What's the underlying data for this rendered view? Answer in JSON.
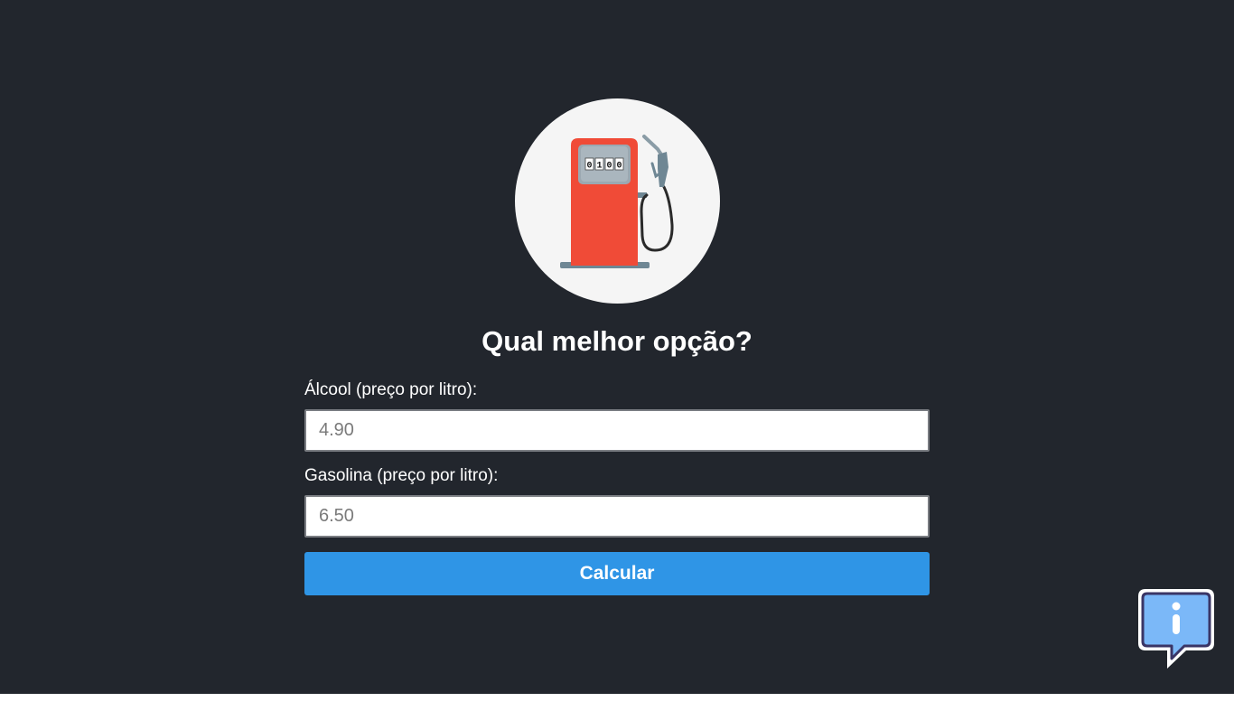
{
  "logo": {
    "icon": "fuel-pump-icon",
    "counter_digits": [
      "0",
      "1",
      "0",
      "0"
    ]
  },
  "title": "Qual melhor opção?",
  "form": {
    "alcool": {
      "label": "Álcool (preço por litro):",
      "placeholder": "4.90"
    },
    "gasolina": {
      "label": "Gasolina (preço por litro):",
      "placeholder": "6.50"
    },
    "submit_label": "Calcular"
  },
  "info_button": {
    "icon": "info-speech-bubble-icon"
  },
  "colors": {
    "background": "#22262d",
    "accent": "#2f95e6",
    "pump_red": "#f04b37"
  }
}
